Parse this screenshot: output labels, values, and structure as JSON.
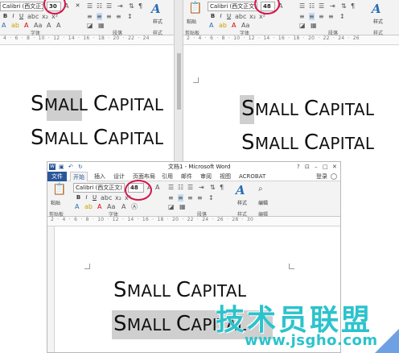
{
  "left_pane": {
    "font_name": "Calibri (西文正文)",
    "font_size": "30",
    "group_font": "字体",
    "group_paragraph": "段落",
    "group_style": "样式",
    "style_label": "样式",
    "line1": {
      "first": "S",
      "rest1": "MALL ",
      "cap": "C",
      "rest2": "APITAL"
    },
    "line2": {
      "first": "S",
      "rest1": "MALL ",
      "cap": "C",
      "rest2": "APITAL"
    }
  },
  "right_pane": {
    "paste_label": "粘贴",
    "clipboard_label": "剪贴板",
    "font_name": "Calibri (西文正文)",
    "font_size": "48",
    "group_font": "字体",
    "group_paragraph": "段落",
    "group_style": "样式",
    "style_label": "样式",
    "line1": {
      "first": "S",
      "rest1": "MALL ",
      "cap": "C",
      "rest2": "APITAL"
    },
    "line2": {
      "first": "S",
      "rest1": "MALL ",
      "cap": "C",
      "rest2": "APITAL"
    }
  },
  "bottom_window": {
    "title": "文档1 - Microsoft Word",
    "login": "登录",
    "tabs": [
      "文件",
      "开始",
      "插入",
      "设计",
      "页面布局",
      "引用",
      "邮件",
      "审阅",
      "视图",
      "ACROBAT"
    ],
    "paste_label": "粘贴",
    "clipboard_label": "剪贴板",
    "font_name": "Calibri (西文正文)",
    "font_size": "48",
    "group_font": "字体",
    "group_paragraph": "段落",
    "group_style": "样式",
    "group_edit": "编辑",
    "style_label": "样式",
    "edit_label": "编辑",
    "line1": {
      "first": "S",
      "rest1": "MALL ",
      "cap": "C",
      "rest2": "APITAL"
    },
    "line2": {
      "first": "S",
      "rest1": "MALL ",
      "cap": "C",
      "rest2": "APITAL"
    }
  },
  "watermark": {
    "text": "技术员联盟",
    "url": "www.jsgho.com"
  },
  "colors": {
    "ring": "#d3164a",
    "word_blue": "#2b579a",
    "highlight": "#cfcfcf",
    "watermark": "#2cc3cc"
  }
}
